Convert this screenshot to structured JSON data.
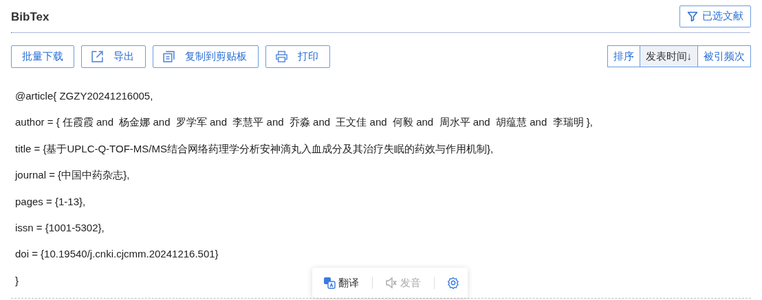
{
  "title": "BibTex",
  "selected_docs_button": "已选文献",
  "actions": [
    {
      "label": "批量下载",
      "kind": "plain"
    },
    {
      "label": "导出",
      "kind": "export"
    },
    {
      "label": "复制到剪贴板",
      "kind": "copy"
    },
    {
      "label": "打印",
      "kind": "print"
    }
  ],
  "sort": {
    "label": "排序",
    "options": [
      {
        "label": "发表时间",
        "selected": true,
        "arrow": "↓"
      },
      {
        "label": "被引频次",
        "selected": false
      }
    ]
  },
  "bibtex_lines": [
    "@article{ ZGZY20241216005,",
    "author = { 任霞霞 and  杨金娜 and  罗学军 and  李慧平 and  乔淼 and  王文佳 and  何毅 and  周水平 and  胡蕴慧 and  李瑞明 },",
    "title = {基于UPLC-Q-TOF-MS/MS结合网络药理学分析安神滴丸入血成分及其治疗失眠的药效与作用机制},",
    "journal = {中国中药杂志},",
    "pages = {1-13},",
    "issn = {1001-5302},",
    "doi = {10.19540/j.cnki.cjcmm.20241216.501}",
    "}"
  ],
  "popup_toolbar": [
    {
      "kind": "translate",
      "label": "翻译",
      "disabled": false
    },
    {
      "kind": "speak",
      "label": "发音",
      "disabled": true
    },
    {
      "kind": "settings"
    }
  ]
}
